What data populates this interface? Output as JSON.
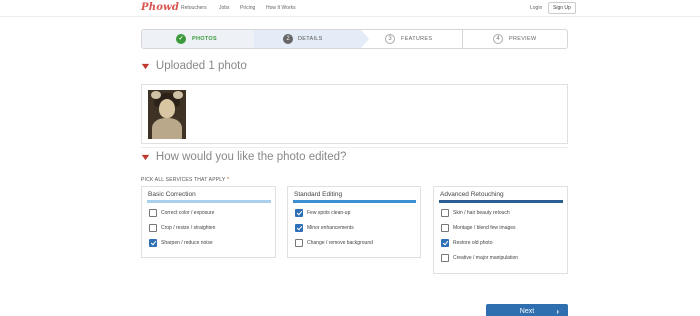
{
  "nav": {
    "logo": "Phowd",
    "links": [
      "Retouchers",
      "Jobs",
      "Pricing",
      "How It Works"
    ],
    "login": "Login",
    "signup": "Sign Up"
  },
  "stepper": {
    "steps": [
      {
        "number": "✓",
        "label": "PHOTOS",
        "state": "complete"
      },
      {
        "number": "2",
        "label": "DETAILS",
        "state": "active"
      },
      {
        "number": "3",
        "label": "FEATURES",
        "state": "upcoming"
      },
      {
        "number": "4",
        "label": "PREVIEW",
        "state": "upcoming"
      }
    ]
  },
  "upload": {
    "heading": "Uploaded 1 photo"
  },
  "edit": {
    "heading": "How would you like the photo edited?",
    "pick_label": "PICK ALL SERVICES THAT APPLY",
    "required_mark": "*"
  },
  "panels": [
    {
      "title": "Basic Correction",
      "options": [
        {
          "label": "Correct color / exposure",
          "checked": false
        },
        {
          "label": "Crop / resize / straighten",
          "checked": false
        },
        {
          "label": "Sharpen / reduce noise",
          "checked": true
        }
      ]
    },
    {
      "title": "Standard Editing",
      "options": [
        {
          "label": "Few spots clean-up",
          "checked": true
        },
        {
          "label": "Minor enhancements",
          "checked": true
        },
        {
          "label": "Change / remove background",
          "checked": false
        }
      ]
    },
    {
      "title": "Advanced Retouching",
      "options": [
        {
          "label": "Skin / hair beauty retouch",
          "checked": false
        },
        {
          "label": "Montage / blend few images",
          "checked": false
        },
        {
          "label": "Restore old photo",
          "checked": true
        },
        {
          "label": "Creative / major manipulation",
          "checked": false
        }
      ]
    }
  ],
  "actions": {
    "next": "Next",
    "next_icon": "chevron-right-icon"
  },
  "colors": {
    "brand": "#d9534f",
    "accent": "#2f6fb0",
    "success": "#3c9a3c"
  }
}
